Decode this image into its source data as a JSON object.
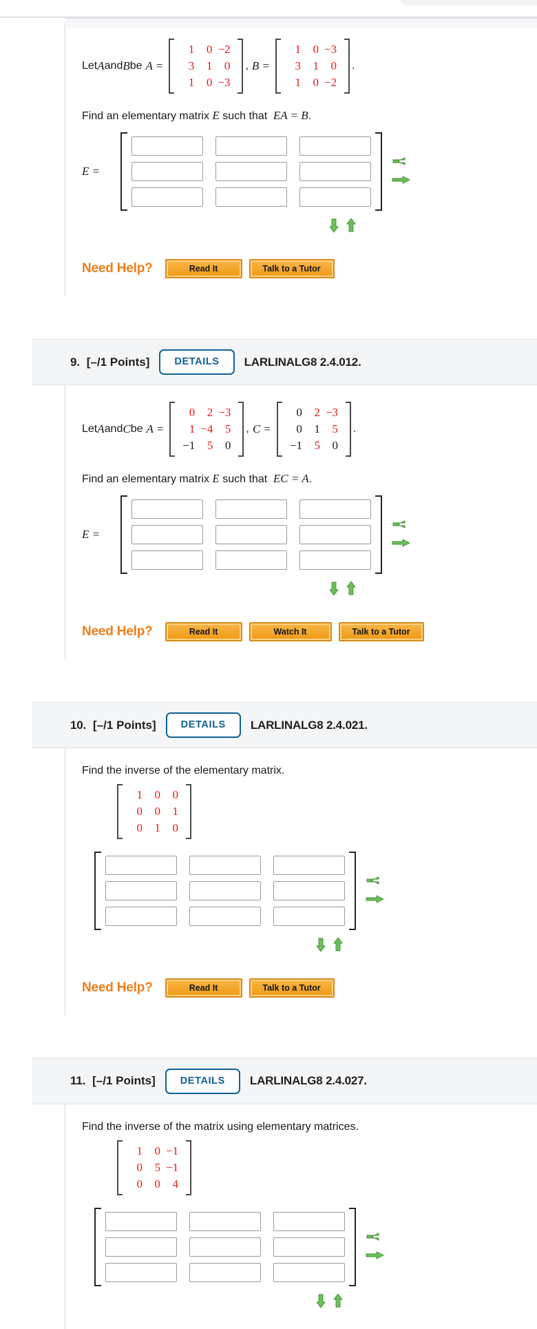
{
  "colors": {
    "matrix_red": "#e8191b",
    "matrix_black": "#1a1a1a",
    "details_blue": "#0d6196",
    "need_help_orange": "#f07d1a",
    "help_button_gold": "#f09a15",
    "arrow_green": "#6cbf5a"
  },
  "labels": {
    "details": "DETAILS",
    "need_help": "Need Help?",
    "read_it": "Read It",
    "watch_it": "Watch It",
    "talk_to_tutor": "Talk to a Tutor",
    "points": "[–/1 Points]"
  },
  "icons": {
    "arrow_left": "arrow-left-icon",
    "arrow_right": "arrow-right-icon",
    "arrow_down": "arrow-down-icon",
    "arrow_up": "arrow-up-icon"
  },
  "problems": [
    {
      "number": "",
      "points": "",
      "code": "",
      "has_header": false,
      "given_prefix": "Let ",
      "given_v1": "A",
      "given_mid": " and ",
      "given_v2": "B",
      "given_suffix": " be ",
      "matrix_a_label": "A",
      "matrix_a": {
        "rows": [
          [
            {
              "t": "1",
              "c": "red"
            },
            {
              "t": "0",
              "c": "red"
            },
            {
              "t": "−2",
              "c": "red"
            }
          ],
          [
            {
              "t": "3",
              "c": "red"
            },
            {
              "t": "1",
              "c": "red"
            },
            {
              "t": "0",
              "c": "red"
            }
          ],
          [
            {
              "t": "1",
              "c": "red"
            },
            {
              "t": "0",
              "c": "red"
            },
            {
              "t": "−3",
              "c": "red"
            }
          ]
        ]
      },
      "separator": ",",
      "matrix_b_label": "B",
      "matrix_b": {
        "rows": [
          [
            {
              "t": "1",
              "c": "red"
            },
            {
              "t": "0",
              "c": "red"
            },
            {
              "t": "−3",
              "c": "red"
            }
          ],
          [
            {
              "t": "3",
              "c": "red"
            },
            {
              "t": "1",
              "c": "red"
            },
            {
              "t": "0",
              "c": "red"
            }
          ],
          [
            {
              "t": "1",
              "c": "red"
            },
            {
              "t": "0",
              "c": "red"
            },
            {
              "t": "−2",
              "c": "red"
            }
          ]
        ]
      },
      "trailing": ".",
      "prompt_pre": "Find an elementary matrix ",
      "prompt_var": "E",
      "prompt_mid": " such that ",
      "prompt_eq": "EA = B",
      "prompt_end": ".",
      "answer_label": "E =",
      "answer_values": [
        [
          "",
          "",
          ""
        ],
        [
          "",
          "",
          ""
        ],
        [
          "",
          "",
          ""
        ]
      ],
      "help_buttons": [
        "Read It",
        "Talk to a Tutor"
      ]
    },
    {
      "number": "9.",
      "points": "[–/1 Points]",
      "code": "LARLINALG8 2.4.012.",
      "has_header": true,
      "given_prefix": "Let ",
      "given_v1": "A",
      "given_mid": " and ",
      "given_v2": "C",
      "given_suffix": " be ",
      "matrix_a_label": "A",
      "matrix_a": {
        "rows": [
          [
            {
              "t": "0",
              "c": "red"
            },
            {
              "t": "2",
              "c": "red"
            },
            {
              "t": "−3",
              "c": "red"
            }
          ],
          [
            {
              "t": "1",
              "c": "red"
            },
            {
              "t": "−4",
              "c": "red"
            },
            {
              "t": "5",
              "c": "red"
            }
          ],
          [
            {
              "t": "−1",
              "c": "blk"
            },
            {
              "t": "5",
              "c": "red"
            },
            {
              "t": "0",
              "c": "blk"
            }
          ]
        ]
      },
      "separator": ",",
      "matrix_b_label": "C",
      "matrix_b": {
        "rows": [
          [
            {
              "t": "0",
              "c": "blk"
            },
            {
              "t": "2",
              "c": "red"
            },
            {
              "t": "−3",
              "c": "red"
            }
          ],
          [
            {
              "t": "0",
              "c": "blk"
            },
            {
              "t": "1",
              "c": "blk"
            },
            {
              "t": "5",
              "c": "red"
            }
          ],
          [
            {
              "t": "−1",
              "c": "blk"
            },
            {
              "t": "5",
              "c": "red"
            },
            {
              "t": "0",
              "c": "blk"
            }
          ]
        ]
      },
      "trailing": ".",
      "prompt_pre": "Find an elementary matrix ",
      "prompt_var": "E",
      "prompt_mid": " such that ",
      "prompt_eq": "EC = A",
      "prompt_end": ".",
      "answer_label": "E =",
      "answer_values": [
        [
          "",
          "",
          ""
        ],
        [
          "",
          "",
          ""
        ],
        [
          "",
          "",
          ""
        ]
      ],
      "help_buttons": [
        "Read It",
        "Watch It",
        "Talk to a Tutor"
      ]
    },
    {
      "number": "10.",
      "points": "[–/1 Points]",
      "code": "LARLINALG8 2.4.021.",
      "has_header": true,
      "prompt_plain": "Find the inverse of the elementary matrix.",
      "single_matrix": {
        "rows": [
          [
            {
              "t": "1",
              "c": "red"
            },
            {
              "t": "0",
              "c": "red"
            },
            {
              "t": "0",
              "c": "red"
            }
          ],
          [
            {
              "t": "0",
              "c": "red"
            },
            {
              "t": "0",
              "c": "red"
            },
            {
              "t": "1",
              "c": "red"
            }
          ],
          [
            {
              "t": "0",
              "c": "red"
            },
            {
              "t": "1",
              "c": "red"
            },
            {
              "t": "0",
              "c": "red"
            }
          ]
        ]
      },
      "answer_label": "",
      "answer_values": [
        [
          "",
          "",
          ""
        ],
        [
          "",
          "",
          ""
        ],
        [
          "",
          "",
          ""
        ]
      ],
      "help_buttons": [
        "Read It",
        "Talk to a Tutor"
      ]
    },
    {
      "number": "11.",
      "points": "[–/1 Points]",
      "code": "LARLINALG8 2.4.027.",
      "has_header": true,
      "prompt_plain": "Find the inverse of the matrix using elementary matrices.",
      "single_matrix": {
        "rows": [
          [
            {
              "t": "1",
              "c": "red"
            },
            {
              "t": "0",
              "c": "red"
            },
            {
              "t": "−1",
              "c": "red"
            }
          ],
          [
            {
              "t": "0",
              "c": "red"
            },
            {
              "t": "5",
              "c": "red"
            },
            {
              "t": "−1",
              "c": "red"
            }
          ],
          [
            {
              "t": "0",
              "c": "red"
            },
            {
              "t": "0",
              "c": "red"
            },
            {
              "t": "4",
              "c": "red"
            }
          ]
        ]
      },
      "answer_label": "",
      "answer_values": [
        [
          "",
          "",
          ""
        ],
        [
          "",
          "",
          ""
        ],
        [
          "",
          "",
          ""
        ]
      ],
      "help_buttons": []
    }
  ]
}
